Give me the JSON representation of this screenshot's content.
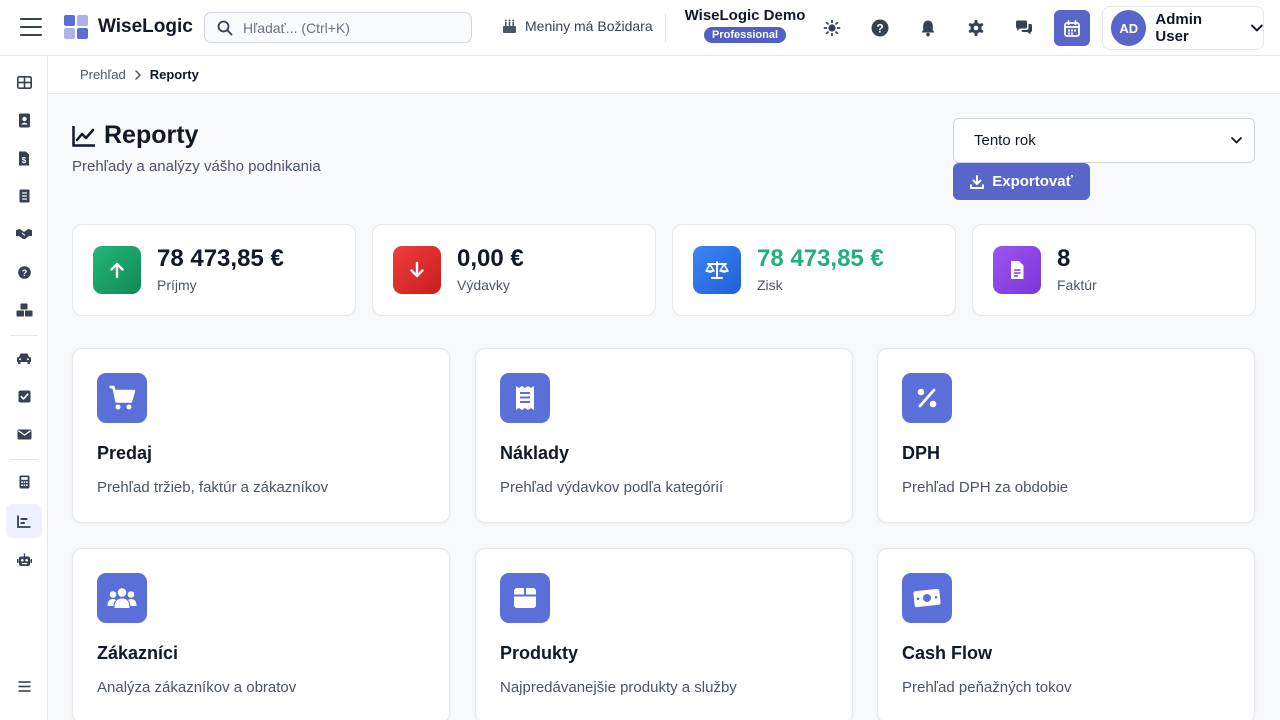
{
  "app": {
    "name": "WiseLogic"
  },
  "search": {
    "placeholder": "Hľadať... (Ctrl+K)"
  },
  "nameday": {
    "text": "Meniny má Božidara"
  },
  "company": {
    "name": "WiseLogic Demo",
    "plan": "Professional"
  },
  "user": {
    "initials": "AD",
    "name": "Admin User"
  },
  "breadcrumb": {
    "parent": "Prehľad",
    "current": "Reporty"
  },
  "page": {
    "title": "Reporty",
    "subtitle": "Prehľady a analýzy vášho podnikania"
  },
  "filter": {
    "selected": "Tento rok"
  },
  "export": {
    "label": "Exportovať"
  },
  "stats": [
    {
      "value": "78 473,85 €",
      "label": "Príjmy",
      "icon": "arrow-up-icon",
      "color": "#1aa366"
    },
    {
      "value": "0,00 €",
      "label": "Výdavky",
      "icon": "arrow-down-icon",
      "color": "#e02b2b"
    },
    {
      "value": "78 473,85 €",
      "label": "Zisk",
      "icon": "scale-icon",
      "color": "#2f6fe4",
      "value_color": "#22b07a"
    },
    {
      "value": "8",
      "label": "Faktúr",
      "icon": "invoice-icon",
      "color": "#8b45e6"
    }
  ],
  "reports": [
    {
      "title": "Predaj",
      "desc": "Prehľad tržieb, faktúr a zákazníkov",
      "icon": "cart-icon"
    },
    {
      "title": "Náklady",
      "desc": "Prehľad výdavkov podľa kategórií",
      "icon": "receipt-icon"
    },
    {
      "title": "DPH",
      "desc": "Prehľad DPH za obdobie",
      "icon": "percent-icon"
    },
    {
      "title": "Zákazníci",
      "desc": "Analýza zákazníkov a obratov",
      "icon": "users-icon"
    },
    {
      "title": "Produkty",
      "desc": "Najpredávanejšie produkty a služby",
      "icon": "box-icon"
    },
    {
      "title": "Cash Flow",
      "desc": "Prehľad peňažných tokov",
      "icon": "money-icon"
    }
  ],
  "sidebar": {
    "items": [
      {
        "icon": "dashboard-icon"
      },
      {
        "icon": "contacts-icon"
      },
      {
        "icon": "invoices-icon"
      },
      {
        "icon": "documents-icon"
      },
      {
        "icon": "handshake-icon"
      },
      {
        "icon": "help-icon"
      },
      {
        "icon": "boxes-icon"
      },
      {
        "icon": "car-icon"
      },
      {
        "icon": "tasks-icon"
      },
      {
        "icon": "mail-icon"
      },
      {
        "icon": "calculator-icon"
      },
      {
        "icon": "reports-icon",
        "active": true
      },
      {
        "icon": "robot-icon"
      },
      {
        "icon": "menu-icon"
      }
    ]
  },
  "colors": {
    "accent": "#5865c9",
    "card_icon": "#5b6fd8"
  }
}
